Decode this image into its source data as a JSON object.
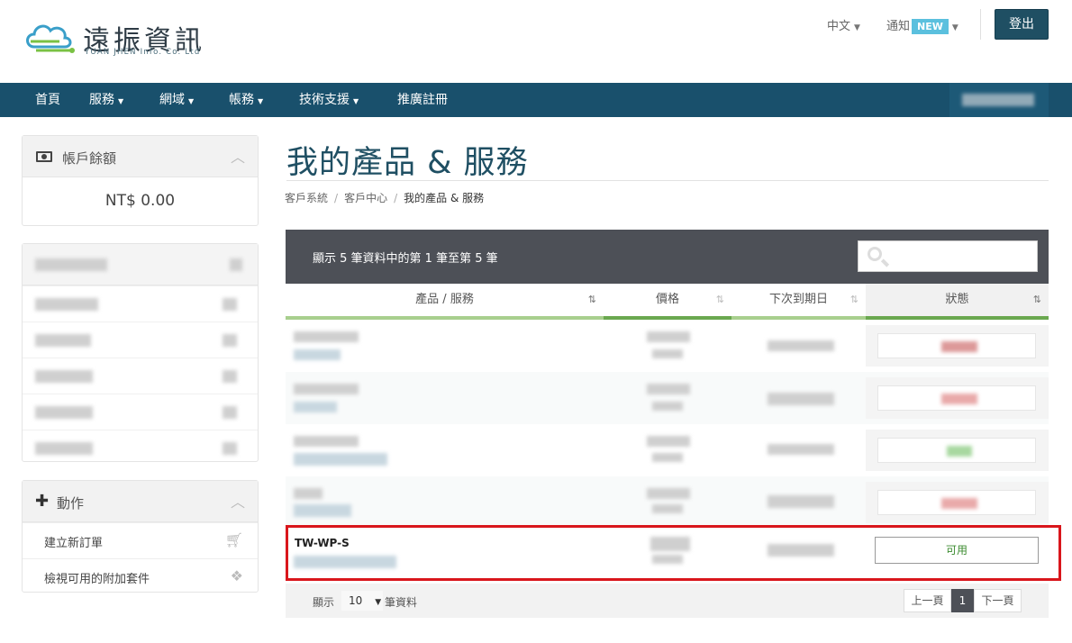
{
  "brand": {
    "title": "遠振資訊",
    "subtitle": "YUAN JHEN Info. Co. Ltd"
  },
  "header": {
    "lang": "中文",
    "notify": "通知",
    "notify_badge": "NEW",
    "logout": "登出"
  },
  "nav": {
    "items": [
      {
        "label": "首頁",
        "dropdown": false
      },
      {
        "label": "服務",
        "dropdown": true
      },
      {
        "label": "網域",
        "dropdown": true
      },
      {
        "label": "帳務",
        "dropdown": true
      },
      {
        "label": "技術支援",
        "dropdown": true
      },
      {
        "label": "推廣註冊",
        "dropdown": false
      }
    ]
  },
  "sidebar": {
    "balance": {
      "title": "帳戶餘額",
      "amount": "NT$ 0.00"
    },
    "actions": {
      "title": "動作",
      "items": [
        {
          "label": "建立新訂單",
          "icon": "cart-icon"
        },
        {
          "label": "檢視可用的附加套件",
          "icon": "cubes-icon"
        }
      ]
    }
  },
  "main": {
    "title": "我的產品 & 服務",
    "breadcrumb": [
      "客戶系統",
      "客戶中心",
      "我的產品 & 服務"
    ],
    "table": {
      "info": "顯示 5 筆資料中的第 1 筆至第 5 筆",
      "columns": [
        "產品 / 服務",
        "價格",
        "下次到期日",
        "狀態"
      ],
      "highlighted_row": {
        "product": "TW-WP-S",
        "status": "可用"
      }
    },
    "footer": {
      "show_label": "顯示",
      "page_size": "10",
      "after_label": "筆資料",
      "prev": "上一頁",
      "current": "1",
      "next": "下一頁"
    }
  },
  "colors": {
    "nav": "#19506c",
    "accent": "#1f4f63",
    "highlight": "#d9161c",
    "status_ok": "#3a8a2e"
  }
}
